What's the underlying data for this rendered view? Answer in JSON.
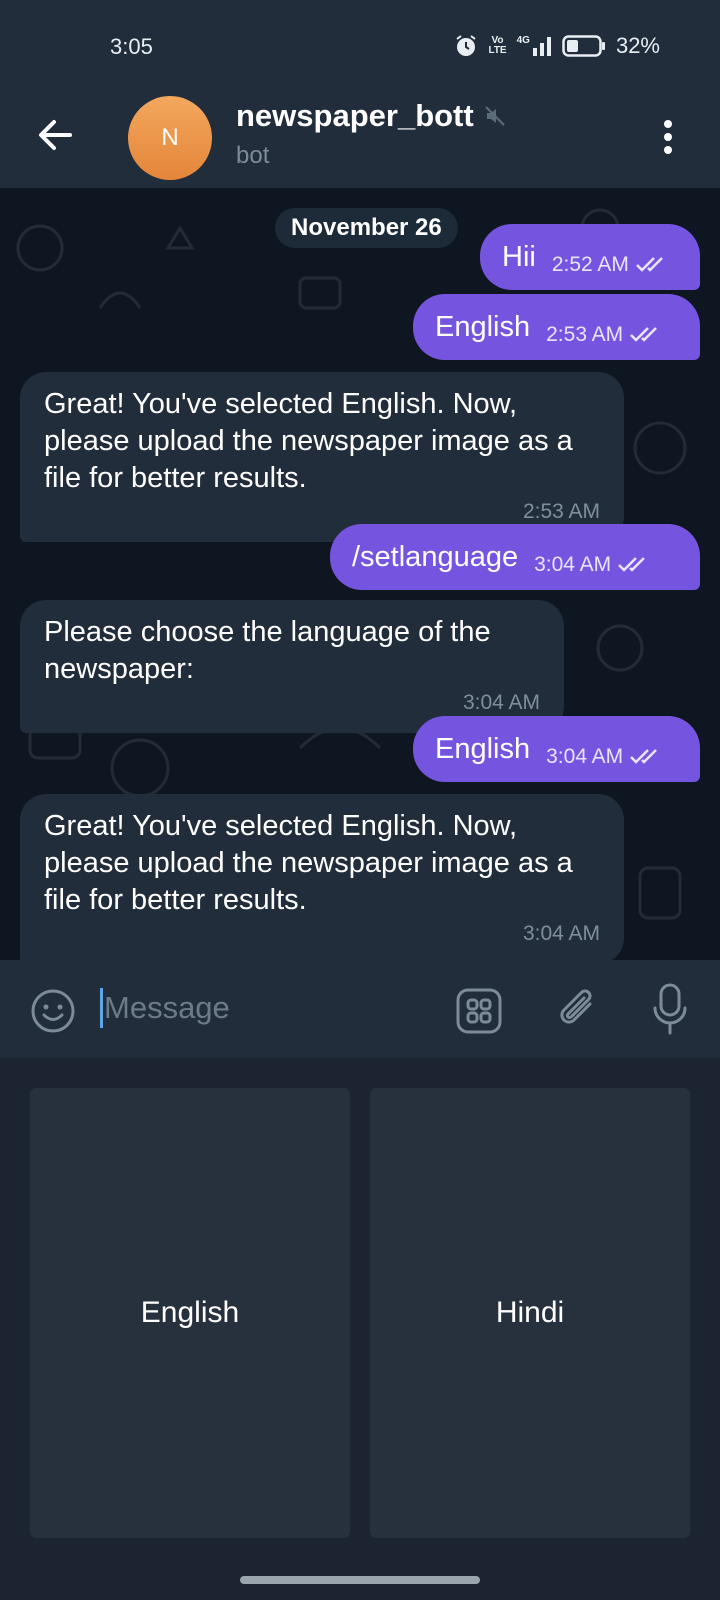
{
  "status_bar": {
    "time": "3:05",
    "network_volte": "Vo",
    "network_lte": "LTE",
    "network_gen": "4G",
    "battery": "32%"
  },
  "header": {
    "avatar_letter": "N",
    "title": "newspaper_bott",
    "subtitle": "bot",
    "avatar_color": "#e98e42"
  },
  "chat": {
    "date": "November 26",
    "messages": [
      {
        "direction": "out",
        "text": "Hii",
        "time": "2:52 AM",
        "read": true
      },
      {
        "direction": "out",
        "text": "English",
        "time": "2:53 AM",
        "read": true
      },
      {
        "direction": "in",
        "text": "Great! You've selected English. Now, please upload the newspaper image as a file for better results.",
        "time": "2:53 AM"
      },
      {
        "direction": "out",
        "text": "/setlanguage",
        "time": "3:04 AM",
        "read": true
      },
      {
        "direction": "in",
        "text": "Please choose the language of the newspaper:",
        "time": "3:04 AM"
      },
      {
        "direction": "out",
        "text": "English",
        "time": "3:04 AM",
        "read": true
      },
      {
        "direction": "in",
        "text": "Great! You've selected English. Now, please upload the newspaper image as a file for better results.",
        "time": "3:04 AM"
      }
    ]
  },
  "input": {
    "placeholder": "Message"
  },
  "keyboard": {
    "buttons": [
      "English",
      "Hindi"
    ]
  },
  "colors": {
    "outgoing_bubble": "#7554e0",
    "incoming_bubble": "#212d3b",
    "chat_background": "#0e1621",
    "header_background": "#212d3b"
  }
}
